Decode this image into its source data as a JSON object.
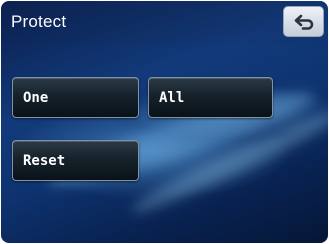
{
  "screen": {
    "title": "Protect",
    "back_icon": "return-arrow-icon"
  },
  "buttons": {
    "one_label": "One",
    "all_label": "All",
    "reset_label": "Reset"
  }
}
